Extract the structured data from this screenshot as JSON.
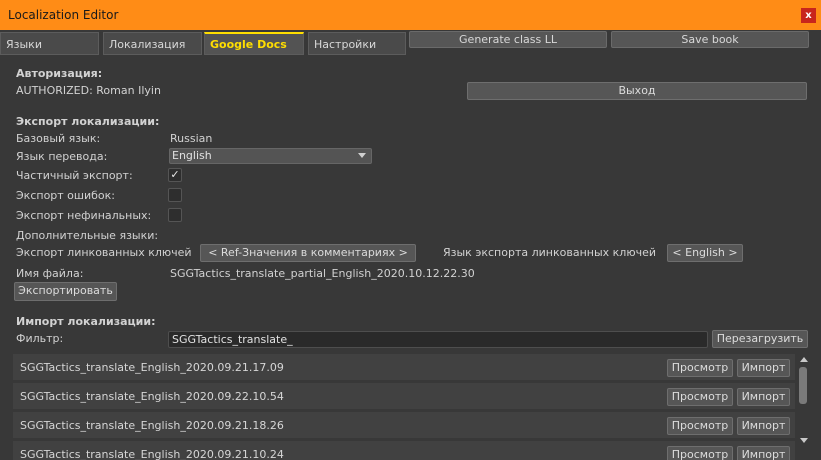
{
  "window": {
    "title": "Localization Editor",
    "close_glyph": "x"
  },
  "tabs": [
    "Языки",
    "Локализация",
    "Google Docs",
    "Настройки"
  ],
  "active_tab": "Google Docs",
  "toolbar": {
    "generate_label": "Generate class LL",
    "save_label": "Save book"
  },
  "auth": {
    "heading": "Авторизация:",
    "status": "AUTHORIZED: Roman Ilyin",
    "logout_label": "Выход"
  },
  "export": {
    "heading": "Экспорт локализации:",
    "base_lang_label": "Базовый язык:",
    "base_lang_value": "Russian",
    "target_lang_label": "Язык перевода:",
    "target_lang_value": "English",
    "partial_label": "Частичный экспорт:",
    "partial_checked": "✓",
    "errors_label": "Экспорт ошибок:",
    "nonfinal_label": "Экспорт нефинальных:",
    "extra_langs_label": "Дополнительные языки:",
    "linked_keys_label": "Экспорт линкованных ключей",
    "linked_keys_value": "< Ref-Значения в комментариях >",
    "linked_lang_label": "Язык экспорта линкованных ключей",
    "linked_lang_value": "< English >",
    "filename_label": "Имя файла:",
    "filename_value": "SGGTactics_translate_partial_English_2020.10.12.22.30",
    "export_button": "Экспортировать"
  },
  "import": {
    "heading": "Импорт локализации:",
    "filter_label": "Фильтр:",
    "filter_value": "SGGTactics_translate_",
    "reload_button": "Перезагрузить",
    "view_label": "Просмотр",
    "import_label": "Импорт",
    "files": [
      "SGGTactics_translate_English_2020.09.21.17.09",
      "SGGTactics_translate_English_2020.09.22.10.54",
      "SGGTactics_translate_English_2020.09.21.18.26",
      "SGGTactics_translate_English_2020.09.21.10.24"
    ]
  },
  "colors": {
    "title_bar": "#ff8c16",
    "active_tab_text": "#ffde00",
    "close_button": "#c8251c",
    "background": "#383838"
  }
}
